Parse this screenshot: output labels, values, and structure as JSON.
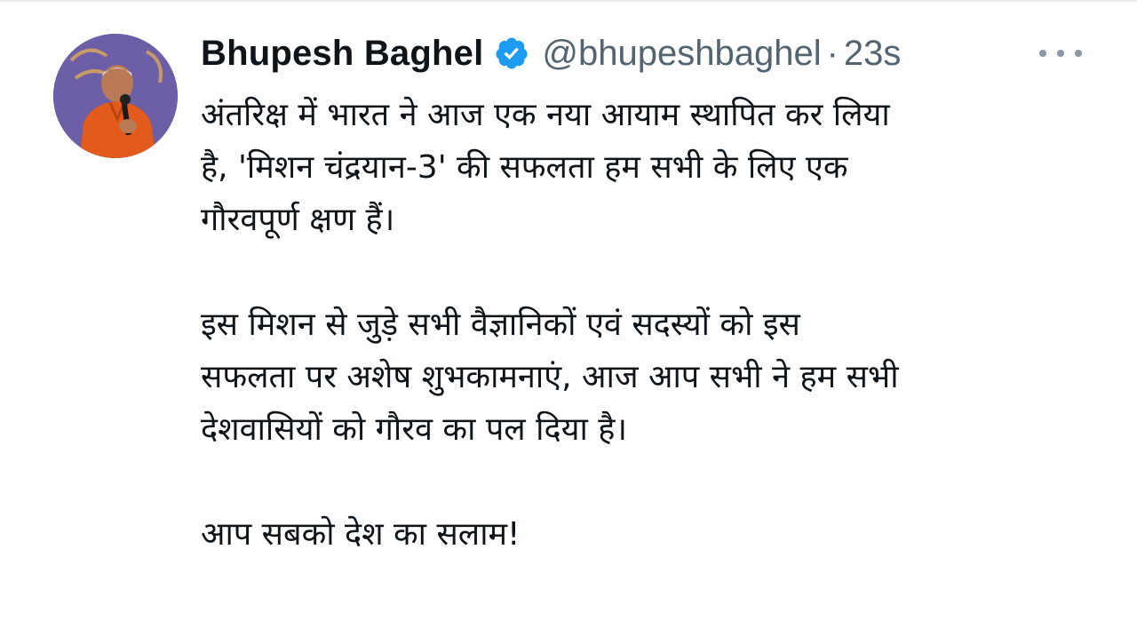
{
  "tweet": {
    "author_name": "Bhupesh Baghel",
    "handle": "@bhupeshbaghel",
    "separator": "·",
    "time": "23s",
    "verified": true,
    "verified_color": "#1d9bf0",
    "avatar_icon": "profile-photo",
    "more_icon": "more-horizontal-icon",
    "paragraphs": [
      [
        "अंतरिक्ष में भारत ने आज एक नया आयाम स्थापित कर लिया",
        "है, 'मिशन चंद्रयान-3' की सफलता हम सभी के लिए एक",
        "गौरवपूर्ण क्षण हैं।"
      ],
      [
        "इस मिशन से जुड़े सभी वैज्ञानिकों एवं सदस्यों को इस",
        "सफलता पर अशेष शुभकामनाएं, आज आप सभी ने हम सभी",
        "देशवासियों को गौरव का पल दिया है।"
      ],
      [
        "आप सबको देश का सलाम!"
      ]
    ]
  }
}
